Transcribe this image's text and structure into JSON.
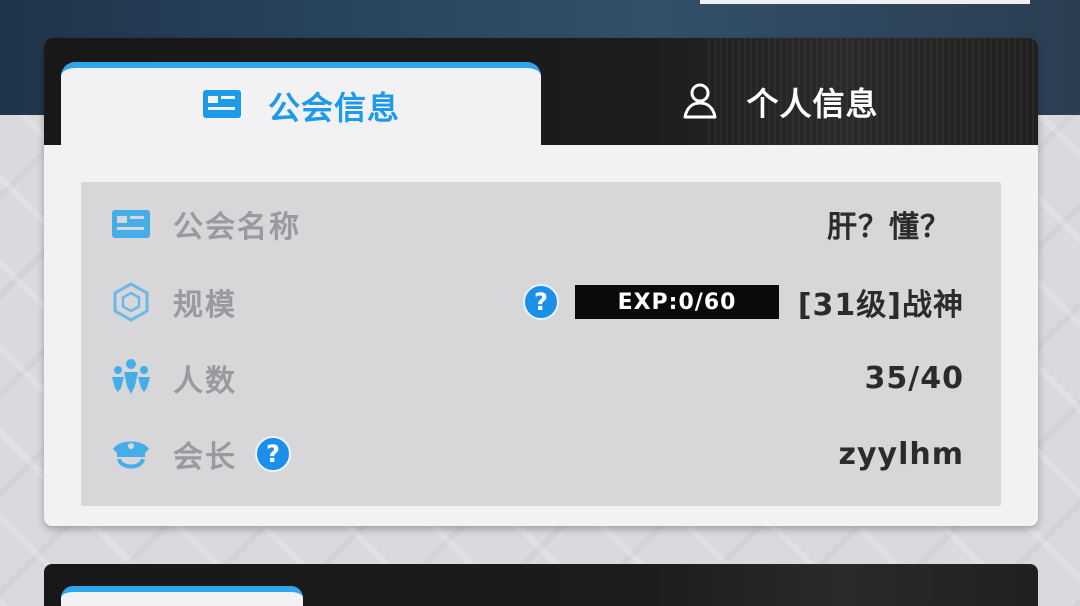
{
  "tabs": [
    {
      "label": "公会信息",
      "icon": "card-icon",
      "active": true
    },
    {
      "label": "个人信息",
      "icon": "person-icon",
      "active": false
    }
  ],
  "guild": {
    "name_label": "公会名称",
    "name_value": "肝？懂？",
    "scale_label": "规模",
    "exp_text": "EXP:0/60",
    "scale_value": "[31级]战神",
    "members_label": "人数",
    "members_value": "35/40",
    "leader_label": "会长",
    "leader_value": "zyylhm",
    "help_glyph": "?"
  },
  "colors": {
    "accent": "#2fa6ec",
    "help": "#1c8fe8",
    "label": "#9a9a9e",
    "value": "#2b2b2b"
  }
}
